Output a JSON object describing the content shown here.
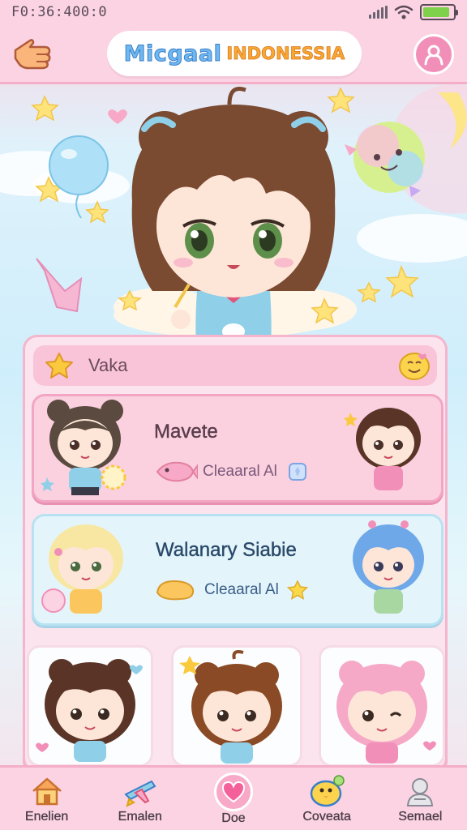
{
  "status_bar": {
    "time": "F0:36:400:0",
    "battery_level": 0.9
  },
  "header": {
    "title_part1": "Micgaal",
    "title_part2": "INDONESSIA",
    "back_icon": "pointing-hand-icon",
    "profile_icon": "user-icon"
  },
  "panel": {
    "header_label": "Vaka",
    "header_icon": "star-icon",
    "header_right_icon": "smiley-icon",
    "cards": [
      {
        "title": "Mavete",
        "subtitle": "Cleaaral Al",
        "icon": "fish-icon",
        "badge_icon": "gem-icon"
      },
      {
        "title": "Walanary Siabie",
        "subtitle": "Cleaaral Al",
        "icon": "bean-icon",
        "badge_icon": "star-icon"
      }
    ]
  },
  "bottom_nav": {
    "items": [
      {
        "label": "Enelien",
        "icon": "home-icon"
      },
      {
        "label": "Emalen",
        "icon": "toy-plane-icon"
      },
      {
        "label": "Doe",
        "icon": "heart-icon"
      },
      {
        "label": "Coveata",
        "icon": "chick-icon"
      },
      {
        "label": "Semael",
        "icon": "person-icon"
      }
    ]
  },
  "colors": {
    "pink_bg": "#fbd3e2",
    "pink_border": "#f4aec8",
    "sky": "#cfeefb",
    "title_blue": "#6fb8f0",
    "title_orange": "#f7a833"
  }
}
